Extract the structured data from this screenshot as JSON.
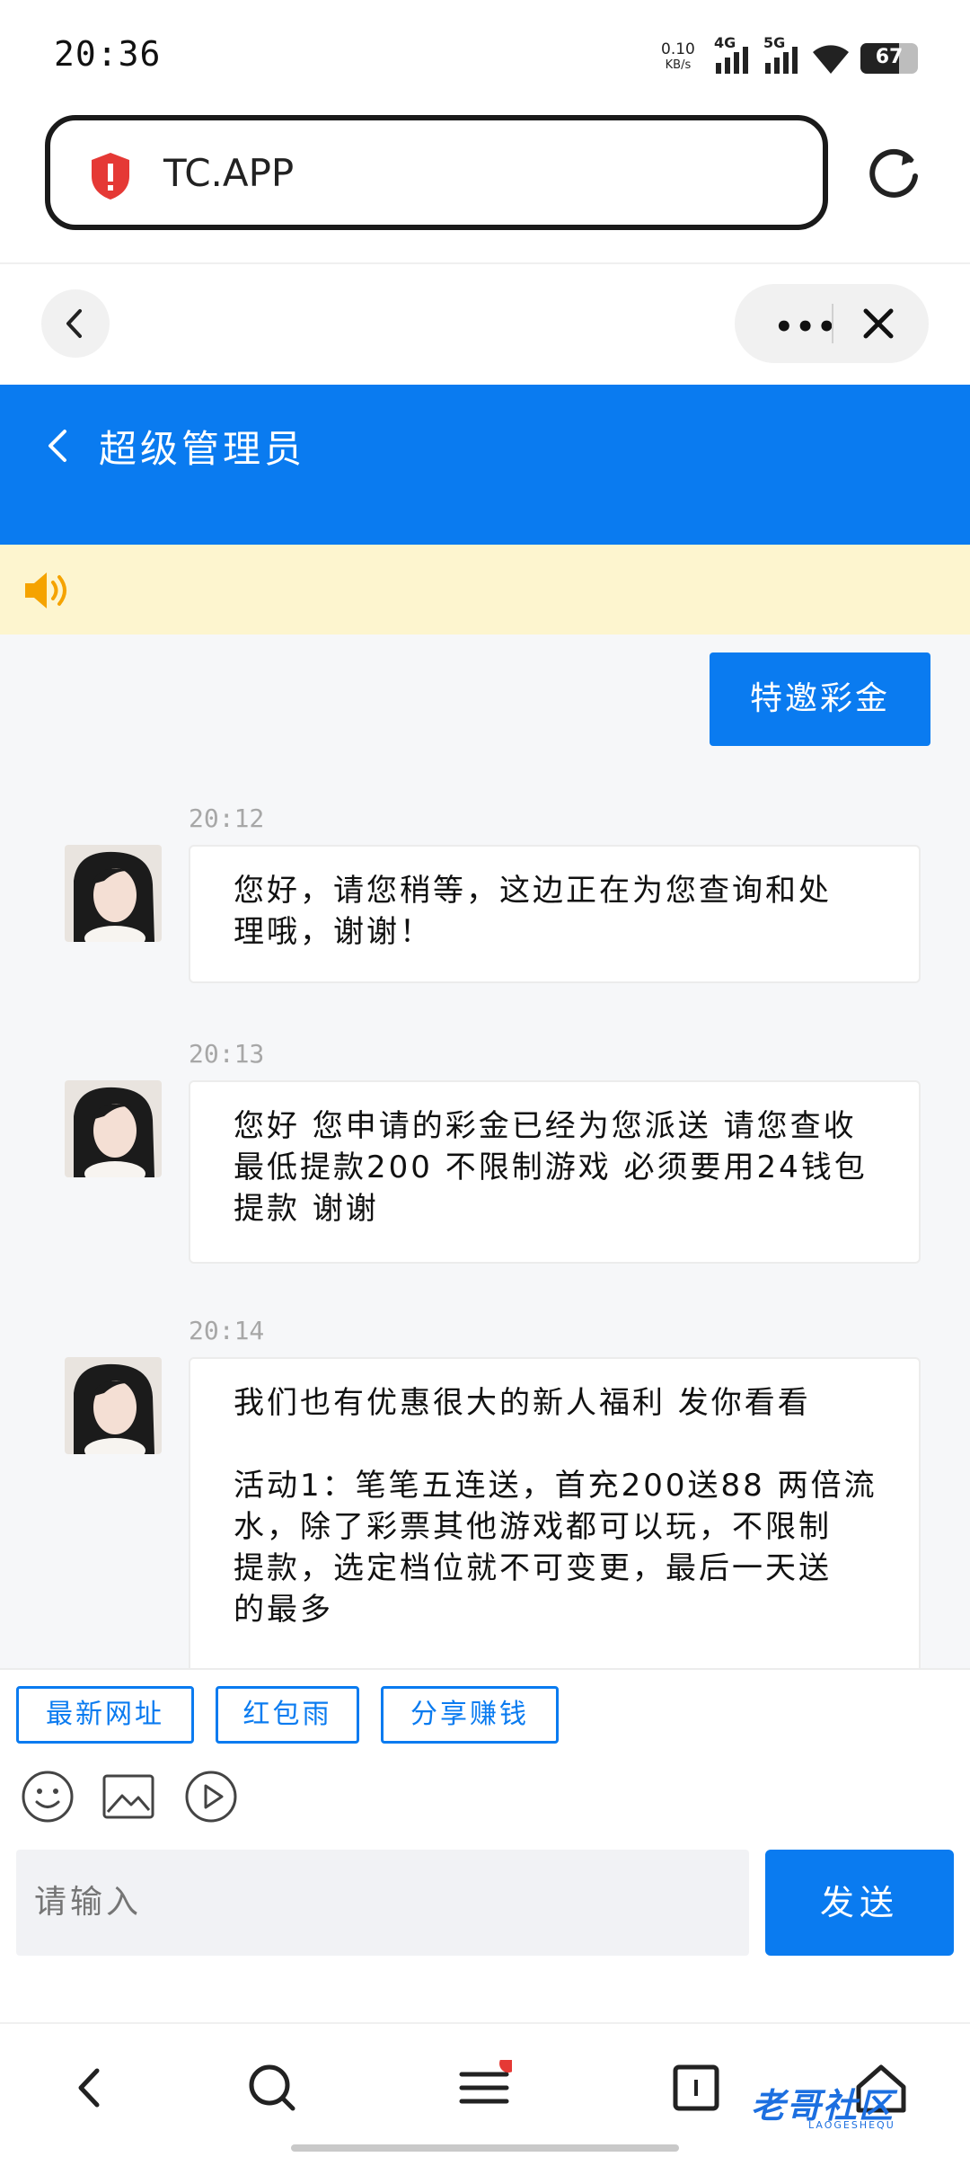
{
  "status_bar": {
    "time": "20:36",
    "speed_value": "0.10",
    "speed_unit": "KB/s",
    "net1": "4G",
    "net2": "5G",
    "battery": "67",
    "battery_level": 0.67
  },
  "browser": {
    "url": "TC.APP"
  },
  "header": {
    "title": "超级管理员"
  },
  "chat": {
    "outgoing": "特邀彩金",
    "messages": [
      {
        "time": "20:12",
        "text": "您好，请您稍等，这边正在为您查询和处\n理哦，谢谢！"
      },
      {
        "time": "20:13",
        "text": "您好 您申请的彩金已经为您派送 请您查收\n最低提款200 不限制游戏 必须要用24钱包\n提款 谢谢"
      },
      {
        "time": "20:14",
        "text": "我们也有优惠很大的新人福利 发你看看\n\n活动1：笔笔五连送，首充200送88 两倍流\n水，除了彩票其他游戏都可以玩，不限制\n提款，选定档位就不可变更，最后一天送\n的最多"
      }
    ]
  },
  "quick_actions": [
    "最新网址",
    "红包雨",
    "分享赚钱"
  ],
  "composer": {
    "placeholder": "请输入",
    "send_label": "发送"
  },
  "watermark": {
    "text": "老哥社区",
    "sub": "LAOGESHEQU"
  },
  "colors": {
    "accent": "#0a7bf0",
    "notice_bg": "#fdf5cf",
    "chat_bg": "#f6f7f9"
  }
}
